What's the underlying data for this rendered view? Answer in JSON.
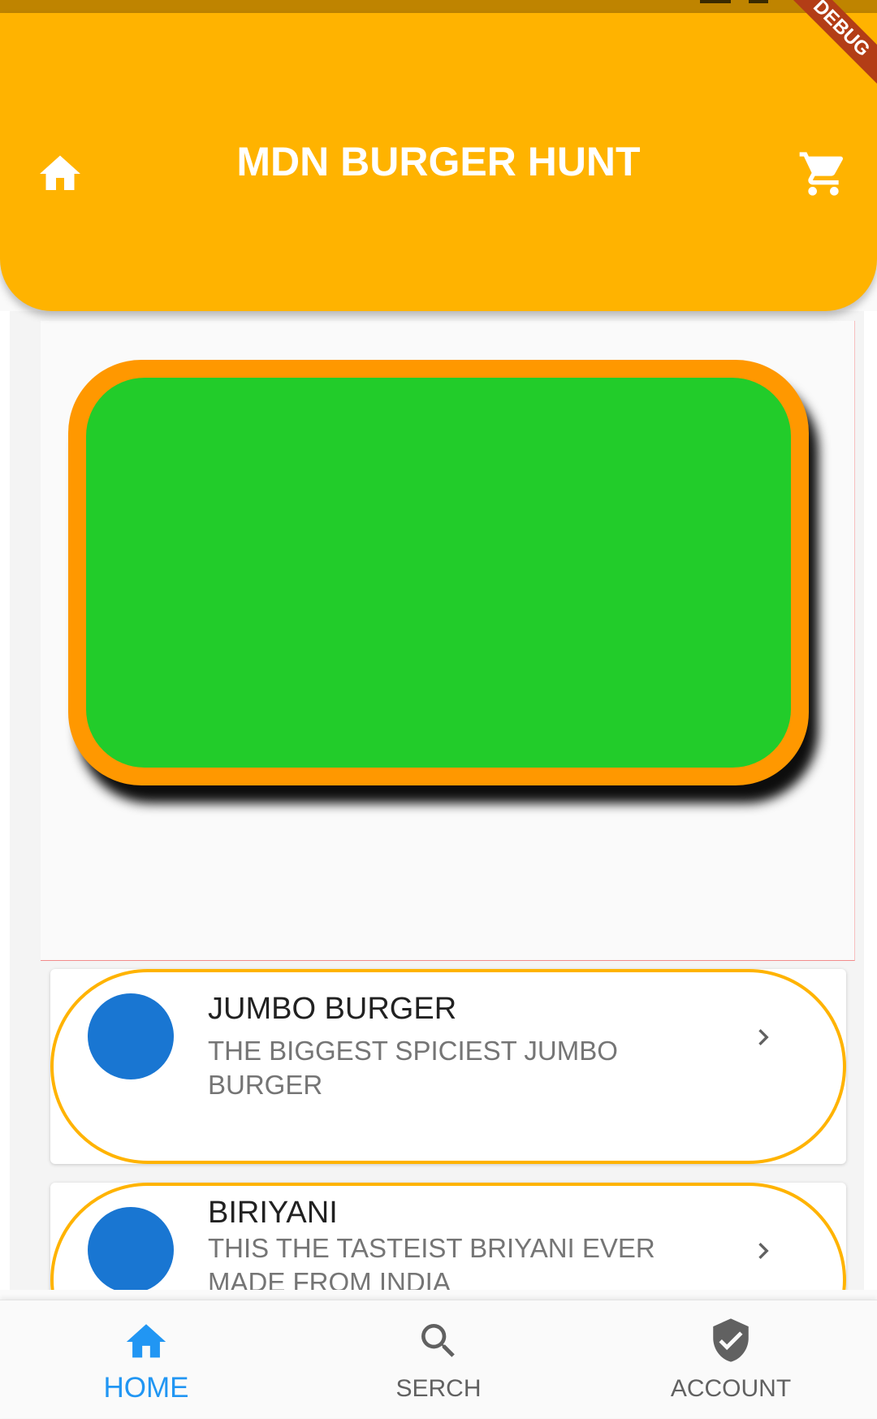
{
  "app_bar": {
    "title": "MDN BURGER HUNT",
    "home_icon": "home-icon",
    "cart_icon": "shopping-cart-icon",
    "background_color": "#ffb300"
  },
  "debug_banner": {
    "label": "DEBUG"
  },
  "banner": {
    "border_color": "#ff9800",
    "fill_color": "#22cc2a"
  },
  "list": {
    "items": [
      {
        "title": "JUMBO BURGER",
        "subtitle": " THE BIGGEST SPICIEST JUMBO BURGER",
        "avatar_color": "#1976d2",
        "trailing_icon": "chevron-right-icon"
      },
      {
        "title": "BIRIYANI",
        "subtitle": "THIS THE TASTEIST BRIYANI EVER MADE FROM INDIA",
        "avatar_color": "#1976d2",
        "trailing_icon": "chevron-right-icon"
      }
    ],
    "border_color": "#ffb300"
  },
  "bottom_nav": {
    "active_color": "#2196f3",
    "inactive_color": "#616161",
    "items": [
      {
        "label": "HOME",
        "icon": "home-icon",
        "active": true
      },
      {
        "label": "SERCH",
        "icon": "search-icon",
        "active": false
      },
      {
        "label": "ACCOUNT",
        "icon": "verified-user-icon",
        "active": false
      }
    ]
  }
}
